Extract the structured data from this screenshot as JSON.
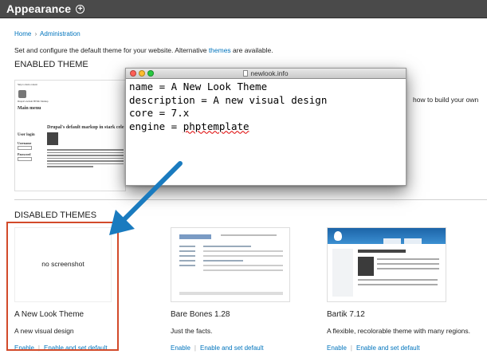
{
  "header": {
    "title": "Appearance",
    "add_icon": "plus-circle-icon"
  },
  "breadcrumb": {
    "home": "Home",
    "separator": "›",
    "administration": "Administration"
  },
  "intro": {
    "text_before": "Set and configure the default theme for your website. Alternative ",
    "link": "themes",
    "text_after": " are available."
  },
  "enabled_section": {
    "heading": "ENABLED THEME",
    "description_fragment": "how to build your own"
  },
  "editor": {
    "filename": "newlook.info",
    "lines": [
      "name = A New Look Theme",
      "description = A new visual design",
      "core = 7.x",
      "engine = phptemplate"
    ],
    "engine_key": "engine = ",
    "engine_value": "phptemplate"
  },
  "annotation": {
    "arrow_color": "#1a7bbf",
    "highlight_color": "#d24a2a"
  },
  "stark_thumb": {
    "skip": "Skip to main content",
    "site": "Drupal's default HTML Markup",
    "menu": "Main menu",
    "title": "Drupal's default markup in stark cele",
    "login": "User login",
    "username": "Username",
    "password": "Password"
  },
  "disabled_section": {
    "heading": "DISABLED THEMES",
    "themes": [
      {
        "name": "A New Look Theme",
        "description": "A new visual design",
        "screenshot_text": "no screenshot",
        "enable": "Enable",
        "enable_default": "Enable and set default"
      },
      {
        "name": "Bare Bones 1.28",
        "description": "Just the facts.",
        "enable": "Enable",
        "enable_default": "Enable and set default"
      },
      {
        "name": "Bartik 7.12",
        "description": "A flexible, recolorable theme with many regions.",
        "enable": "Enable",
        "enable_default": "Enable and set default"
      }
    ]
  }
}
